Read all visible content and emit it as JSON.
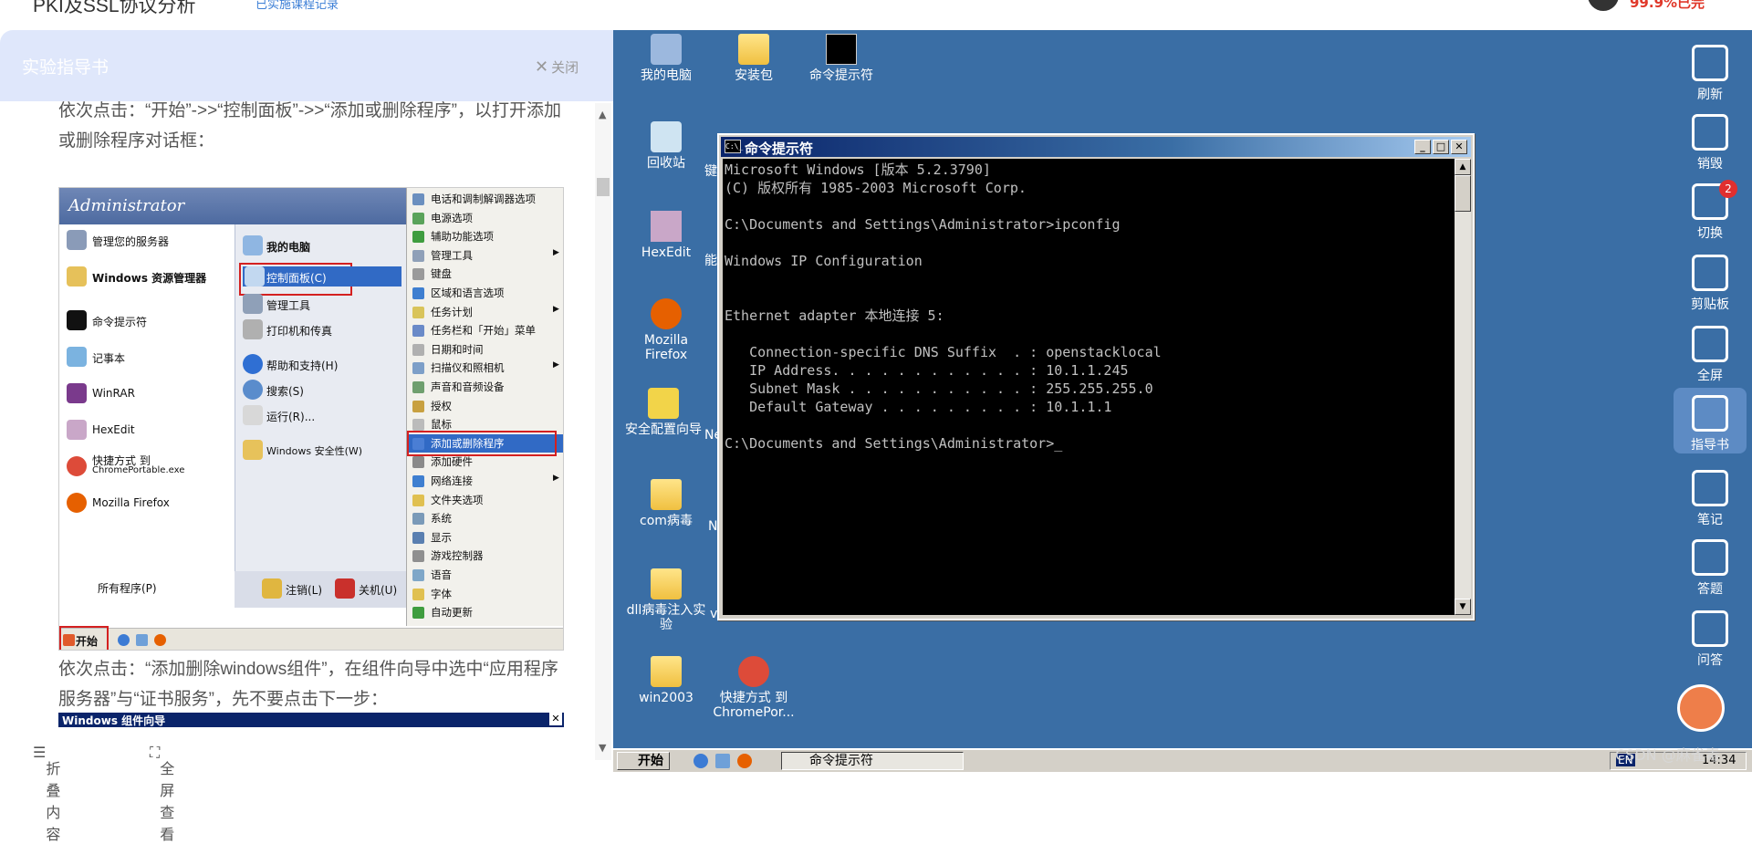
{
  "top": {
    "title": "PKI及SSL协议分析",
    "sublink": "已实施课程记录",
    "user_link": "99.9%已完"
  },
  "guide": {
    "header": "实验指导书",
    "close": "关闭",
    "para1": "依次点击：“开始”->>“控制面板”->>“添加或删除程序”，以打开添加或删除程序对话框：",
    "para2": "依次点击：“添加删除windows组件”，在组件向导中选中“应用程序服务器”与“证书服务”，先不要点击下一步：",
    "footer_fold": "折叠内容",
    "footer_full": "全屏查看",
    "wizard_title": "Windows 组件向导"
  },
  "xp": {
    "user": "Administrator",
    "left_items": [
      "管理您的服务器",
      "Windows 资源管理器",
      "命令提示符",
      "记事本",
      "WinRAR",
      "HexEdit",
      "快捷方式 到",
      "ChromePortable.exe",
      "Mozilla Firefox",
      "所有程序(P)"
    ],
    "mid_items": [
      "我的电脑",
      "控制面板(C)",
      "管理工具",
      "打印机和传真",
      "帮助和支持(H)",
      "搜索(S)",
      "运行(R)...",
      "Windows 安全性(W)"
    ],
    "logoff": "注销(L)",
    "shutdown": "关机(U)",
    "start": "开始",
    "right_items": [
      "电话和调制解调器选项",
      "电源选项",
      "辅助功能选项",
      "管理工具",
      "键盘",
      "区域和语言选项",
      "任务计划",
      "任务栏和「开始」菜单",
      "日期和时间",
      "扫描仪和照相机",
      "声音和音频设备",
      "授权",
      "鼠标",
      "添加或删除程序",
      "添加硬件",
      "网络连接",
      "文件夹选项",
      "系统",
      "显示",
      "游戏控制器",
      "语音",
      "字体",
      "自动更新"
    ]
  },
  "desktop": {
    "icons": [
      "我的电脑",
      "安装包",
      "命令提示符",
      "回收站",
      "HexEdit",
      "Mozilla Firefox",
      "安全配置向导",
      "com病毒",
      "dll病毒注入实验",
      "win2003",
      "快捷方式 到 ChromePor..."
    ],
    "partial": [
      "键",
      "能",
      "Ne",
      "N",
      "v"
    ],
    "taskbar_start": "开始",
    "taskbar_task": "命令提示符",
    "tray_lang": "EN",
    "tray_time": "14:34"
  },
  "cmd": {
    "title": "命令提示符",
    "icon": "C:\\_",
    "lines": [
      "Microsoft Windows [版本 5.2.3790]",
      "(C) 版权所有 1985-2003 Microsoft Corp.",
      "",
      "C:\\Documents and Settings\\Administrator>ipconfig",
      "",
      "Windows IP Configuration",
      "",
      "",
      "Ethernet adapter 本地连接 5:",
      "",
      "   Connection-specific DNS Suffix  . : openstacklocal",
      "   IP Address. . . . . . . . . . . . : 10.1.1.245",
      "   Subnet Mask . . . . . . . . . . . : 255.255.255.0",
      "   Default Gateway . . . . . . . . . : 10.1.1.1",
      "",
      "C:\\Documents and Settings\\Administrator>_"
    ]
  },
  "toolbar": {
    "items": [
      {
        "label": "刷新",
        "icon": "refresh-new-icon"
      },
      {
        "label": "销毁",
        "icon": "trash-icon"
      },
      {
        "label": "切换",
        "icon": "switch-icon",
        "badge": "2"
      },
      {
        "label": "剪贴板",
        "icon": "scissors-icon"
      },
      {
        "label": "全屏",
        "icon": "fullscreen-icon"
      },
      {
        "label": "指导书",
        "icon": "book-icon"
      },
      {
        "label": "笔记",
        "icon": "pencil-icon"
      },
      {
        "label": "答题",
        "icon": "answer-icon"
      },
      {
        "label": "问答",
        "icon": "qa-icon"
      }
    ]
  },
  "watermark": "CSDN @麻雀毒"
}
